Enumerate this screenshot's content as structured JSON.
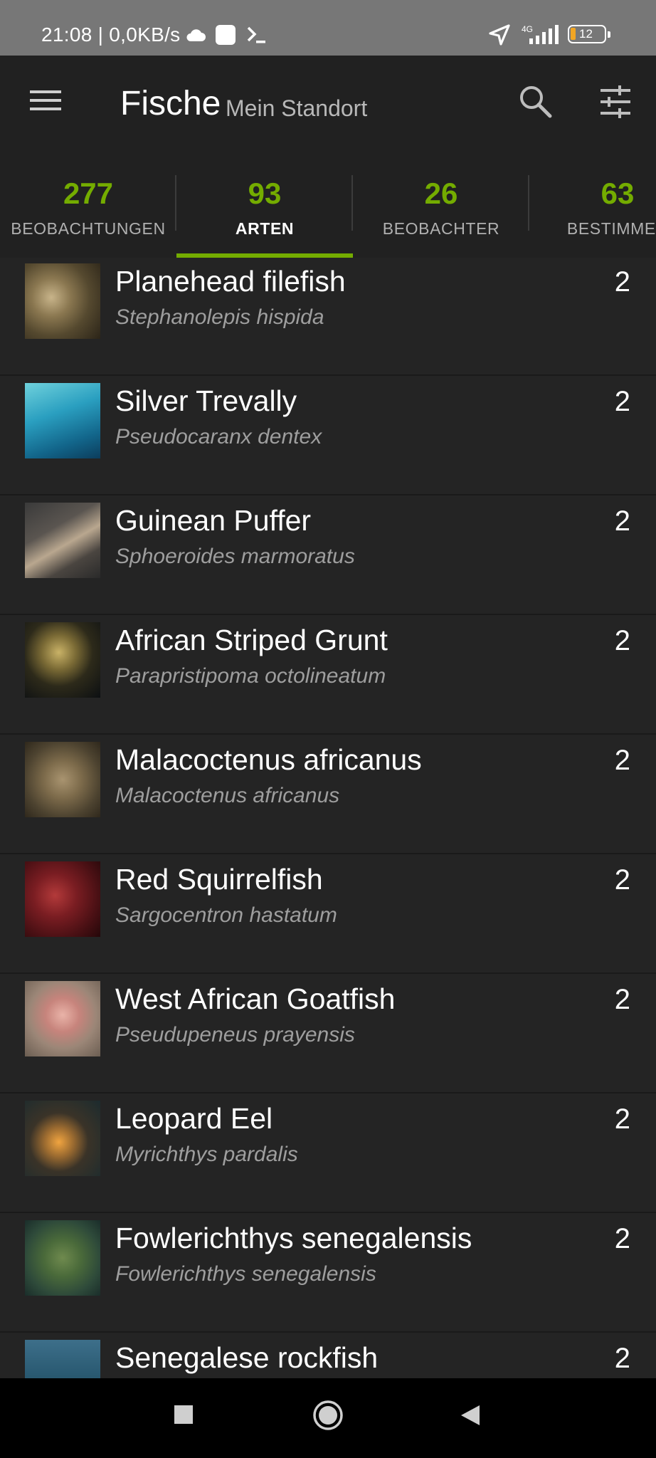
{
  "status_bar": {
    "time_net": "21:08 | 0,0KB/s",
    "network_type": "4G",
    "battery_level": "12",
    "icons": [
      "cloud-icon",
      "square-notification-icon",
      "terminal-icon",
      "location-arrow-icon",
      "signal-icon",
      "battery-icon"
    ]
  },
  "header": {
    "title": "Fische",
    "subtitle": "Mein Standort",
    "icons": [
      "menu-icon",
      "search-icon",
      "filter-sliders-icon"
    ]
  },
  "tabs": [
    {
      "count": "277",
      "label": "BEOBACHTUNGEN"
    },
    {
      "count": "93",
      "label": "ARTEN",
      "active": true
    },
    {
      "count": "26",
      "label": "BEOBACHTER"
    },
    {
      "count": "63",
      "label": "BESTIMMER"
    }
  ],
  "accent_color": "#74ac00",
  "species": [
    {
      "common": "Planehead filefish",
      "scientific": "Stephanolepis hispida",
      "count": "2"
    },
    {
      "common": "Silver Trevally",
      "scientific": "Pseudocaranx dentex",
      "count": "2"
    },
    {
      "common": "Guinean Puffer",
      "scientific": "Sphoeroides marmoratus",
      "count": "2"
    },
    {
      "common": "African Striped Grunt",
      "scientific": "Parapristipoma octolineatum",
      "count": "2"
    },
    {
      "common": "Malacoctenus africanus",
      "scientific": "Malacoctenus africanus",
      "count": "2"
    },
    {
      "common": "Red Squirrelfish",
      "scientific": "Sargocentron hastatum",
      "count": "2"
    },
    {
      "common": "West African Goatfish",
      "scientific": "Pseudupeneus prayensis",
      "count": "2"
    },
    {
      "common": "Leopard Eel",
      "scientific": "Myrichthys pardalis",
      "count": "2"
    },
    {
      "common": "Fowlerichthys senegalensis",
      "scientific": "Fowlerichthys senegalensis",
      "count": "2"
    },
    {
      "common": "Senegalese rockfish",
      "scientific": "",
      "count": "2"
    }
  ],
  "nav_bar": {
    "icons": [
      "recents-square-icon",
      "home-circle-icon",
      "back-triangle-icon"
    ]
  }
}
